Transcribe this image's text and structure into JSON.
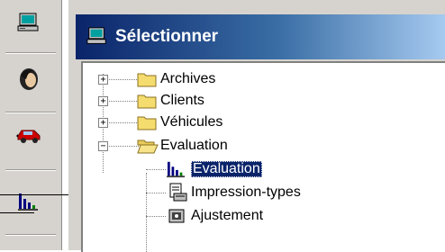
{
  "window": {
    "title": "Sélectionner"
  },
  "toolbar": {
    "items": [
      {
        "icon": "computer-icon"
      },
      {
        "icon": "person-icon"
      },
      {
        "icon": "car-icon"
      },
      {
        "icon": "bar-chart-icon"
      }
    ]
  },
  "tree": {
    "nodes": [
      {
        "label": "Archives",
        "expander": "+",
        "icon": "folder-icon"
      },
      {
        "label": "Clients",
        "expander": "+",
        "icon": "folder-icon"
      },
      {
        "label": "Véhicules",
        "expander": "+",
        "icon": "folder-icon"
      },
      {
        "label": "Evaluation",
        "expander": "−",
        "icon": "folder-open-icon"
      },
      {
        "label": "Evaluation",
        "icon": "bar-chart-icon",
        "selected": true
      },
      {
        "label": "Impression-types",
        "icon": "print-template-icon"
      },
      {
        "label": "Ajustement",
        "icon": "adjustment-icon"
      }
    ]
  },
  "colors": {
    "titlebar_start": "#0a246a",
    "titlebar_end": "#a6caf0",
    "selection": "#0a246a",
    "face": "#d6d3ce"
  }
}
